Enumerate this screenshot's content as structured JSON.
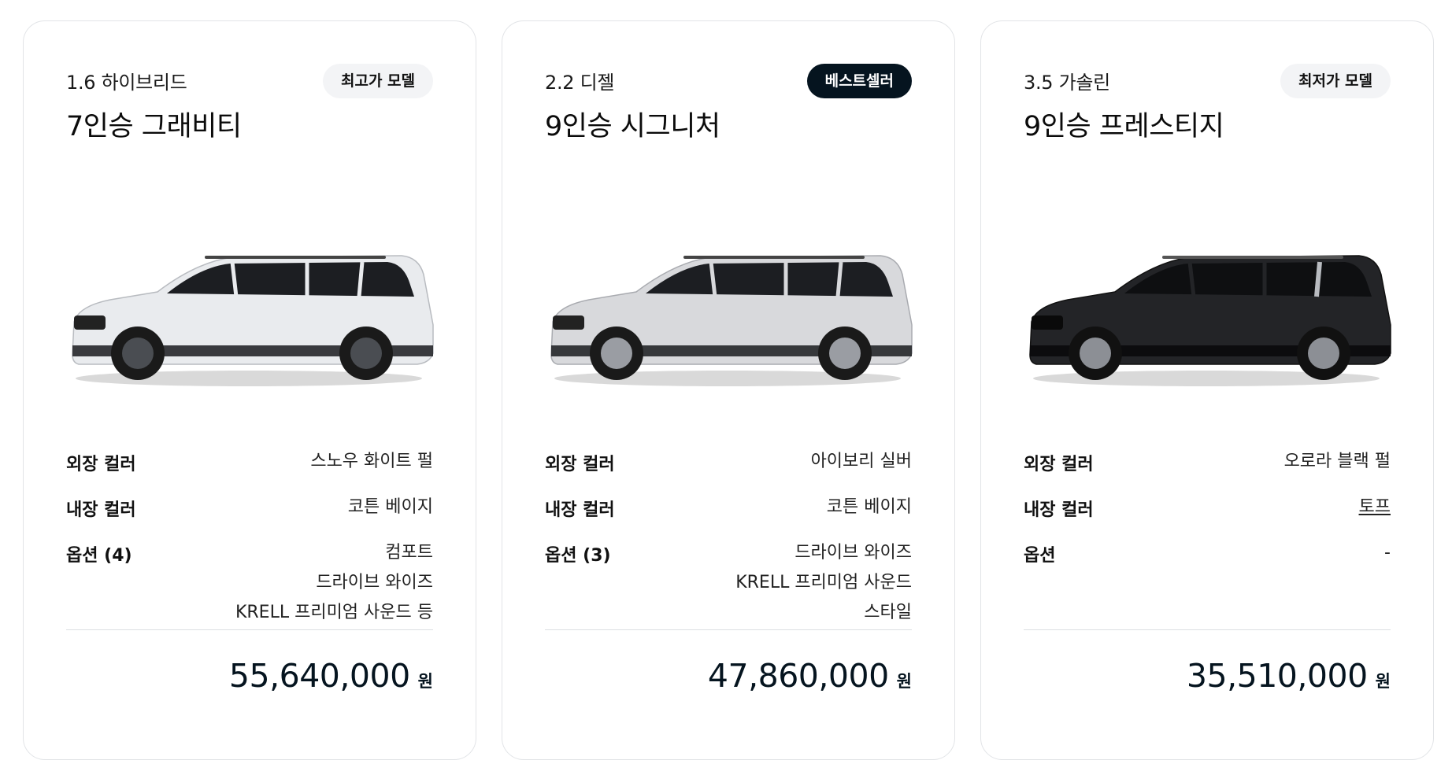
{
  "cards": [
    {
      "engine": "1.6 하이브리드",
      "trim": "7인승 그래비티",
      "badge": "최고가 모델",
      "badge_style": "light",
      "car_color": "#e9ebee",
      "rows": [
        {
          "label": "외장 컬러",
          "values": [
            "스노우 화이트 펄"
          ]
        },
        {
          "label": "내장 컬러",
          "values": [
            "코튼 베이지"
          ]
        },
        {
          "label": "옵션 (4)",
          "values": [
            "컴포트",
            "드라이브 와이즈",
            "KRELL 프리미엄 사운드 등"
          ]
        }
      ],
      "price": "55,640,000",
      "price_unit": "원"
    },
    {
      "engine": "2.2 디젤",
      "trim": "9인승 시그니처",
      "badge": "베스트셀러",
      "badge_style": "dark",
      "car_color": "#d8d9dc",
      "rows": [
        {
          "label": "외장 컬러",
          "values": [
            "아이보리 실버"
          ]
        },
        {
          "label": "내장 컬러",
          "values": [
            "코튼 베이지"
          ]
        },
        {
          "label": "옵션 (3)",
          "values": [
            "드라이브 와이즈",
            "KRELL 프리미엄 사운드",
            "스타일"
          ]
        }
      ],
      "price": "47,860,000",
      "price_unit": "원"
    },
    {
      "engine": "3.5 가솔린",
      "trim": "9인승 프레스티지",
      "badge": "최저가 모델",
      "badge_style": "light",
      "car_color": "#232427",
      "rows": [
        {
          "label": "외장 컬러",
          "values": [
            "오로라 블랙 펄"
          ]
        },
        {
          "label": "내장 컬러",
          "values": [
            "토프"
          ]
        },
        {
          "label": "옵션",
          "values": [
            "-"
          ]
        }
      ],
      "price": "35,510,000",
      "price_unit": "원"
    }
  ]
}
